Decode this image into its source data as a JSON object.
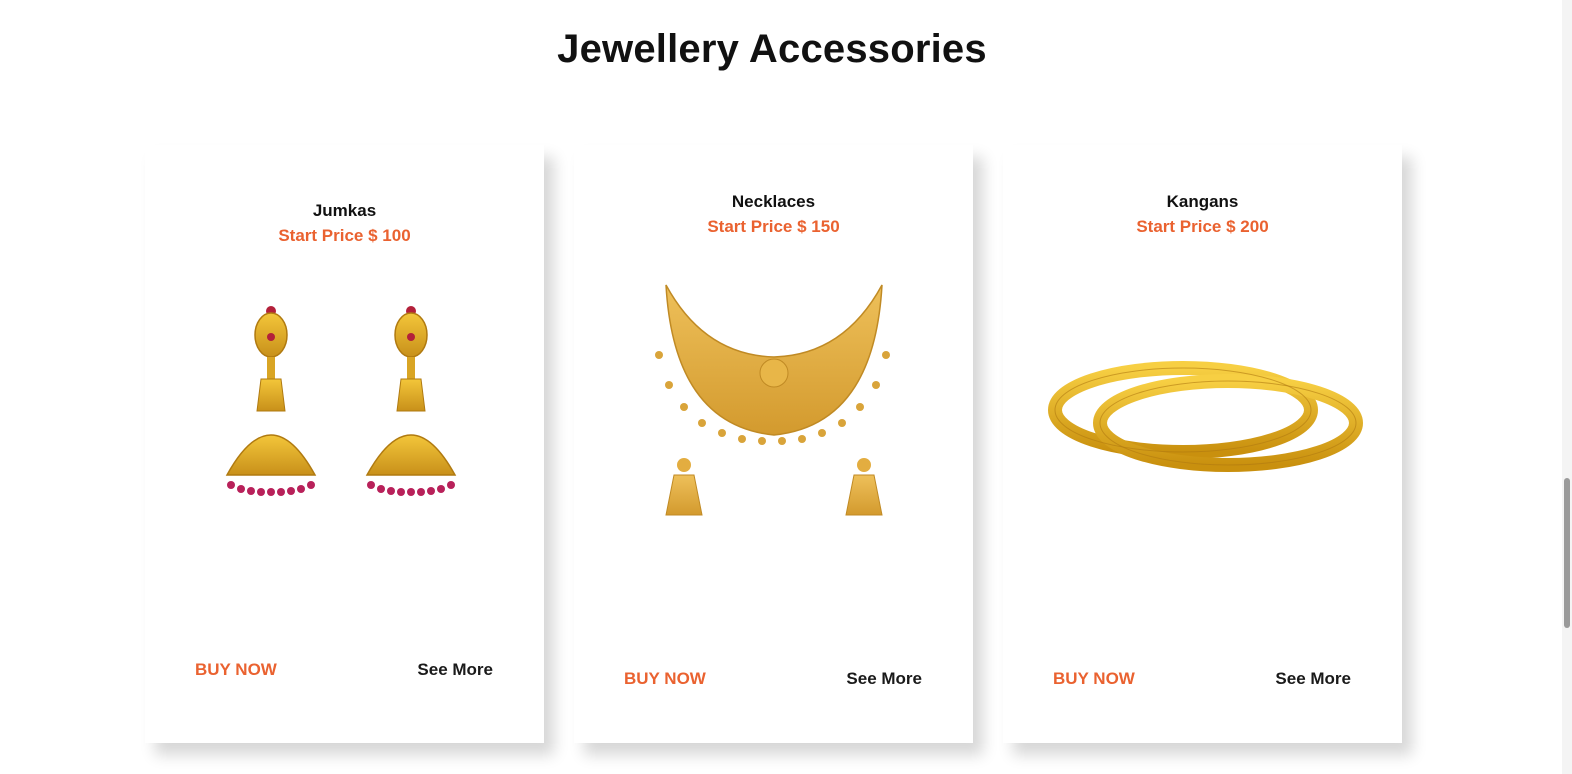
{
  "section": {
    "title": "Jewellery Accessories"
  },
  "products": [
    {
      "name": "Jumkas",
      "price": "Start Price $ 100",
      "image_icon": "jhumka-earrings-image",
      "buy_label": "BUY NOW",
      "more_label": "See More"
    },
    {
      "name": "Necklaces",
      "price": "Start Price $ 150",
      "image_icon": "necklace-set-image",
      "buy_label": "BUY NOW",
      "more_label": "See More"
    },
    {
      "name": "Kangans",
      "price": "Start Price $ 200",
      "image_icon": "bangles-image",
      "buy_label": "BUY NOW",
      "more_label": "See More"
    }
  ],
  "colors": {
    "accent": "#ea6230",
    "text": "#111111",
    "gold": "#e0a822"
  }
}
